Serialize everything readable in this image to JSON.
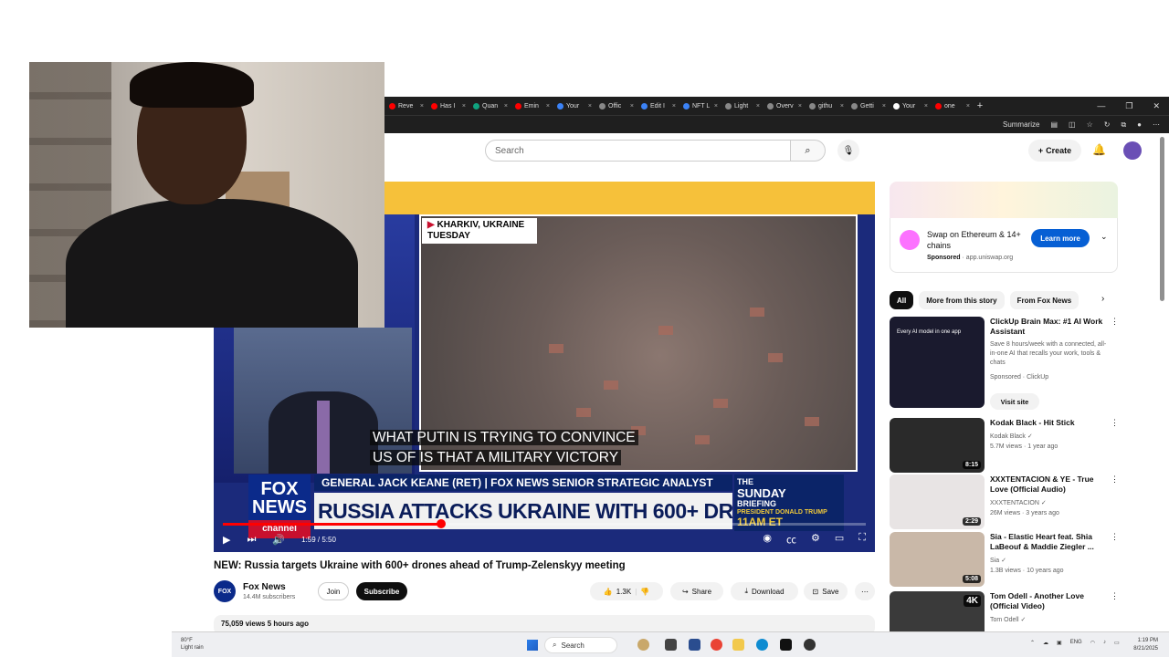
{
  "browser": {
    "tabs": [
      {
        "label": "Reve",
        "color": "#ff0000"
      },
      {
        "label": "Has I",
        "color": "#ff0000"
      },
      {
        "label": "Quan",
        "color": "#10a37f"
      },
      {
        "label": "Emin",
        "color": "#ff0000"
      },
      {
        "label": "Your",
        "color": "#3b82f6"
      },
      {
        "label": "Offic",
        "color": "#888888"
      },
      {
        "label": "Edit I",
        "color": "#3b82f6"
      },
      {
        "label": "NFT L",
        "color": "#3b82f6"
      },
      {
        "label": "Light",
        "color": "#888888"
      },
      {
        "label": "Overv",
        "color": "#888888"
      },
      {
        "label": "githu",
        "color": "#888888"
      },
      {
        "label": "Getti",
        "color": "#888888"
      },
      {
        "label": "Your",
        "color": "#ffffff"
      },
      {
        "label": "one",
        "color": "#ff0000"
      }
    ],
    "summarize_label": "Summarize"
  },
  "youtube": {
    "search_placeholder": "Search",
    "create_label": "Create"
  },
  "player": {
    "location_line1": "KHARKIV, UKRAINE",
    "location_line2": "TUESDAY",
    "subtitle_line1": "WHAT PUTIN IS TRYING TO CONVINCE",
    "subtitle_line2": "US OF IS THAT A MILITARY VICTORY",
    "strap": "GENERAL JACK KEANE (RET) | FOX NEWS SENIOR STRATEGIC ANALYST",
    "headline": "RUSSIA ATTACKS UKRAINE WITH 600+ DRONES",
    "fox_logo_line1": "FOX",
    "fox_logo_line2": "NEWS",
    "fox_logo_line3": "channel",
    "promo_line1": "THE",
    "promo_line2": "SUNDAY",
    "promo_line3": "BRIEFING",
    "promo_line4": "PRESIDENT DONALD TRUMP",
    "promo_line5": "11AM ET",
    "time": "1:59 / 5:50",
    "progress_fraction": 0.34
  },
  "video": {
    "title": "NEW: Russia targets Ukraine with 600+ drones ahead of Trump-Zelenskyy meeting",
    "channel": "Fox News",
    "subscribers": "14.4M subscribers",
    "join": "Join",
    "subscribe": "Subscribe",
    "likes": "1.3K",
    "share": "Share",
    "download": "Download",
    "save": "Save",
    "views_date": "75,059 views  5 hours ago"
  },
  "ad": {
    "title": "Swap on Ethereum & 14+ chains",
    "sponsored": "Sponsored",
    "domain": "app.uniswap.org",
    "cta": "Learn more"
  },
  "chips": [
    "All",
    "More from this story",
    "From Fox News"
  ],
  "recommendations": [
    {
      "title": "ClickUp Brain Max: #1 AI Work Assistant",
      "desc": "Save 8 hours/week with a connected, all-in-one AI that recalls your work, tools & chats",
      "meta1": "Sponsored · ClickUp",
      "meta2": "",
      "duration": "",
      "visit": "Visit site",
      "thumb_text": "Every AI model in one app",
      "thumb_color": "#1a1a2e"
    },
    {
      "title": "Kodak Black - Hit Stick",
      "channel": "Kodak Black",
      "meta2": "5.7M views · 1 year ago",
      "duration": "8:15",
      "thumb_color": "#2a2a2a"
    },
    {
      "title": "XXXTENTACION & YE - True Love (Official Audio)",
      "channel": "XXXTENTACION",
      "meta2": "26M views · 3 years ago",
      "duration": "2:29",
      "thumb_color": "#e8e4e4"
    },
    {
      "title": "Sia - Elastic Heart feat. Shia LaBeouf & Maddie Ziegler ...",
      "channel": "Sia",
      "meta2": "1.3B views · 10 years ago",
      "duration": "5:08",
      "thumb_color": "#c9b8a8"
    },
    {
      "title": "Tom Odell - Another Love (Official Video)",
      "channel": "Tom Odell",
      "meta2": "",
      "duration": "",
      "badge": "4K",
      "thumb_color": "#3a3a3a"
    }
  ],
  "taskbar": {
    "weather_temp": "80°F",
    "weather_desc": "Light rain",
    "search": "Search",
    "lang": "ENG",
    "time": "1:19 PM",
    "date": "8/21/2025"
  }
}
